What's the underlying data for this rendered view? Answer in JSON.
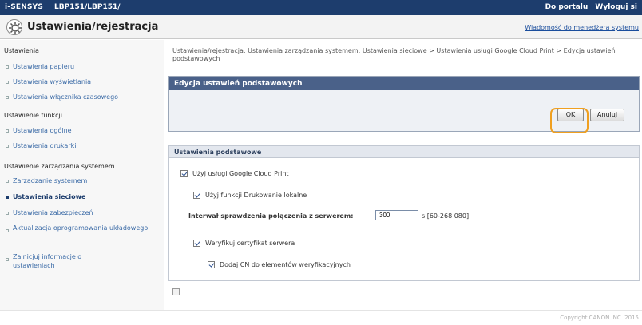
{
  "topbar": {
    "brand": "i-SENSYS",
    "model": "LBP151/LBP151/",
    "portal_link": "Do portalu",
    "logout_link": "Wyloguj si"
  },
  "header": {
    "title": "Ustawienia/rejestracja",
    "message_link": "Wiadomość do menedżera systemu"
  },
  "sidebar": {
    "sections": [
      {
        "label": "Ustawienia",
        "items": [
          {
            "label": "Ustawienia papieru"
          },
          {
            "label": "Ustawienia wyświetlania"
          },
          {
            "label": "Ustawienia włącznika czasowego"
          }
        ]
      },
      {
        "label": "Ustawienie funkcji",
        "items": [
          {
            "label": "Ustawienia ogólne"
          },
          {
            "label": "Ustawienia drukarki"
          }
        ]
      },
      {
        "label": "Ustawienie zarządzania systemem",
        "items": [
          {
            "label": "Zarządzanie systemem"
          },
          {
            "label": "Ustawienia sieciowe"
          },
          {
            "label": "Ustawienia zabezpieczeń"
          },
          {
            "label": "Aktualizacja oprogramowania układowego"
          },
          {
            "label": "Zainicjuj informacje o ustawieniach"
          }
        ]
      }
    ],
    "active_item": "Ustawienia sieciowe"
  },
  "main": {
    "breadcrumb": "Ustawienia/rejestracja: Ustawienia zarządzania systemem: Ustawienia sieciowe > Ustawienia usługi Google Cloud Print > Edycja ustawień podstawowych",
    "edit_panel": {
      "title": "Edycja ustawień podstawowych",
      "ok_label": "OK",
      "cancel_label": "Anuluj"
    },
    "basic_panel": {
      "title": "Ustawienia podstawowe",
      "use_gcp_label": "Użyj usługi Google Cloud Print",
      "use_gcp_checked": true,
      "local_print_label": "Użyj funkcji Drukowanie lokalne",
      "local_print_checked": true,
      "interval_label": "Interwał sprawdzenia połączenia z serwerem:",
      "interval_value": "300",
      "interval_suffix": "s [60-268 080]",
      "verify_cert_label": "Weryfikuj certyfikat serwera",
      "verify_cert_checked": true,
      "add_cn_label": "Dodaj CN do elementów weryfikacyjnych",
      "add_cn_checked": true
    }
  },
  "footer": {
    "copyright": "Copyright CANON INC. 2015"
  }
}
